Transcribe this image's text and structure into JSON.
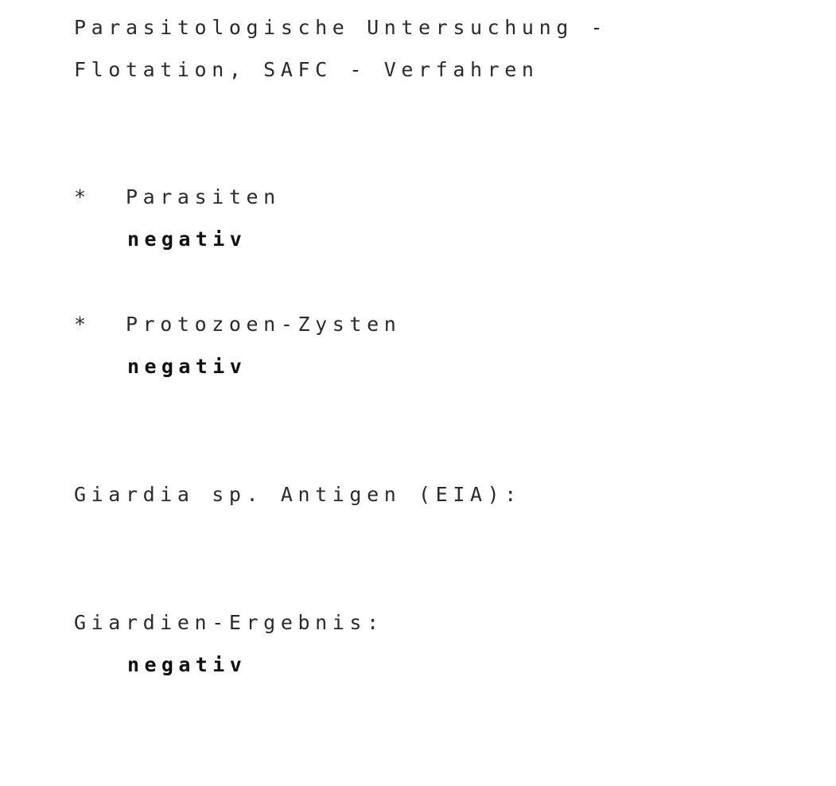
{
  "document": {
    "title_lines": [
      "Parasitologische Untersuchung -",
      "Flotation, SAFC - Verfahren"
    ],
    "findings": [
      {
        "marker": "*",
        "label": "Parasiten",
        "result": "negativ"
      },
      {
        "marker": "*",
        "label": "Protozoen-Zysten",
        "result": "negativ"
      }
    ],
    "antigen_heading": "Giardia sp. Antigen (EIA):",
    "giardia_result": {
      "label": "Giardien-Ergebnis:",
      "value": "negativ"
    },
    "colors": {
      "background": "#ffffff",
      "body_text": "#2b2b2b",
      "emphasis_text": "#111111"
    }
  }
}
